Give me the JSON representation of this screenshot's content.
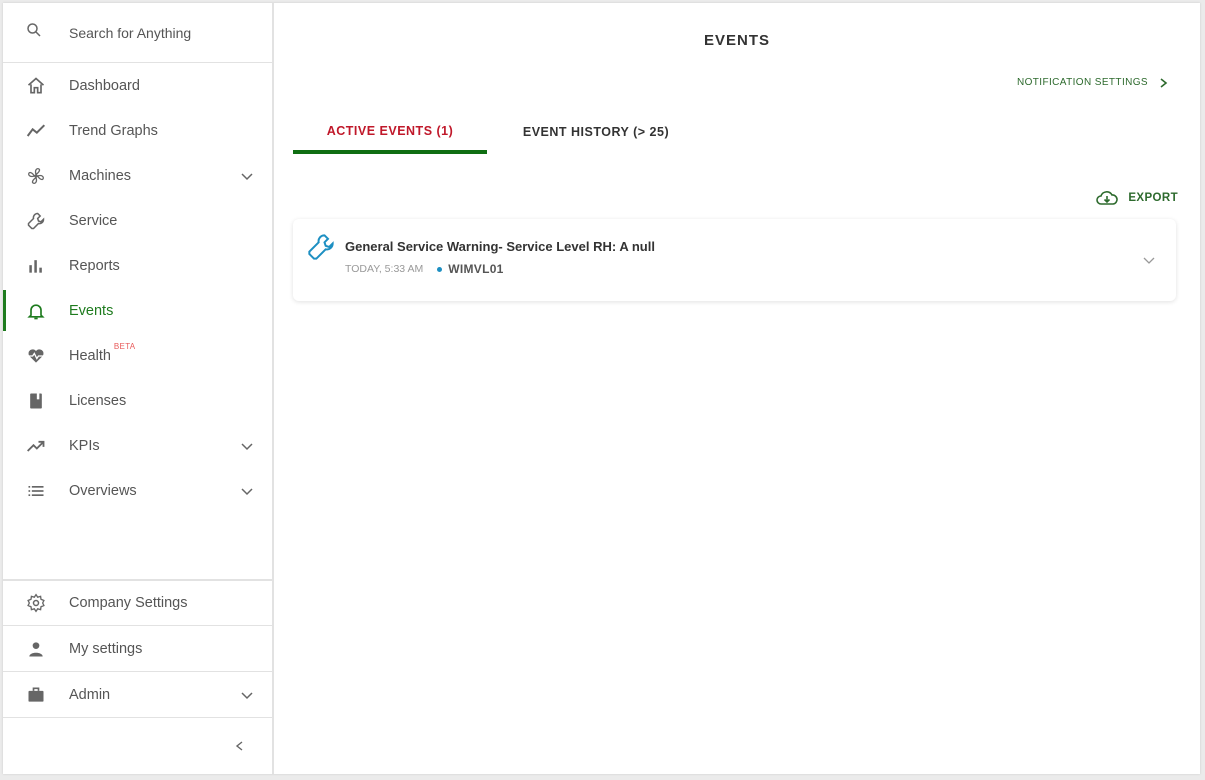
{
  "search": {
    "placeholder": "Search for Anything",
    "icon": "search-icon"
  },
  "sidebar": {
    "items": [
      {
        "label": "Dashboard",
        "icon": "home-icon"
      },
      {
        "label": "Trend Graphs",
        "icon": "trend-line-icon"
      },
      {
        "label": "Machines",
        "icon": "fan-icon",
        "expandable": true
      },
      {
        "label": "Service",
        "icon": "wrench-icon"
      },
      {
        "label": "Reports",
        "icon": "bar-chart-icon"
      },
      {
        "label": "Events",
        "icon": "bell-icon",
        "active": true
      },
      {
        "label": "Health",
        "icon": "heartbeat-icon",
        "badge": "BETA"
      },
      {
        "label": "Licenses",
        "icon": "book-icon"
      },
      {
        "label": "KPIs",
        "icon": "trending-up-icon",
        "expandable": true
      },
      {
        "label": "Overviews",
        "icon": "list-icon",
        "expandable": true
      }
    ],
    "bottom": [
      {
        "label": "Company Settings",
        "icon": "gear-icon"
      },
      {
        "label": "My settings",
        "icon": "person-icon"
      },
      {
        "label": "Admin",
        "icon": "briefcase-icon",
        "expandable": true
      }
    ]
  },
  "main": {
    "title": "EVENTS",
    "notification_settings": "NOTIFICATION SETTINGS",
    "tabs": [
      {
        "label": "ACTIVE EVENTS (1)",
        "active": true
      },
      {
        "label": "EVENT HISTORY (> 25)",
        "active": false
      }
    ],
    "export_label": "EXPORT",
    "events": [
      {
        "title": "General Service Warning- Service Level RH: A null",
        "time": "TODAY, 5:33 AM",
        "machine": "WIMVL01",
        "icon": "wrench-icon"
      }
    ]
  },
  "colors": {
    "accent_green": "#1e7b1e",
    "active_tab_red": "#c0182a",
    "event_icon_blue": "#1d8fc2"
  }
}
